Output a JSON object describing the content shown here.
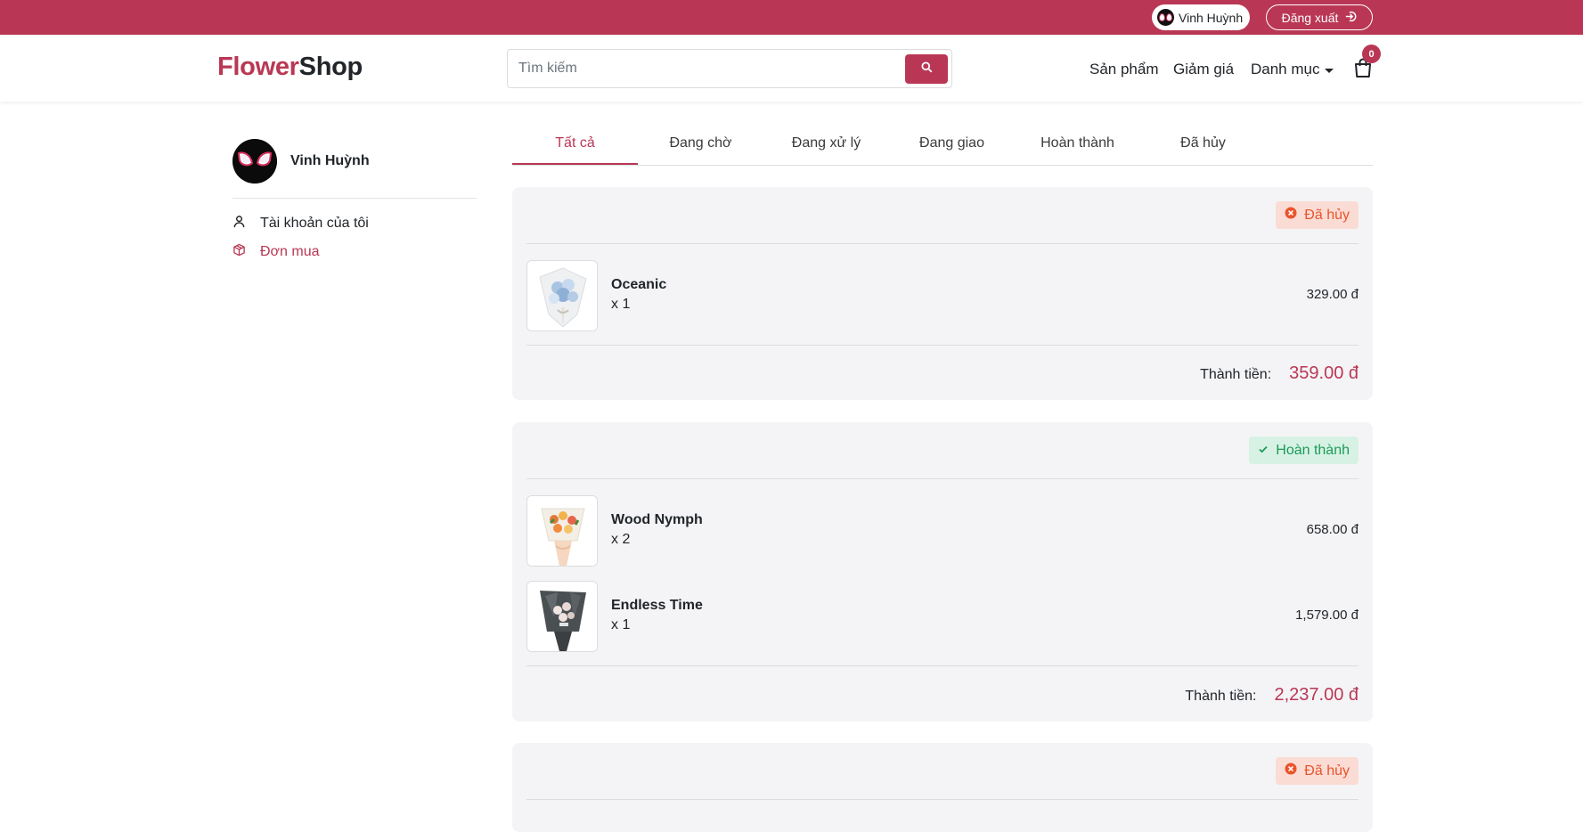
{
  "topbar": {
    "user_name": "Vinh Huỳnh",
    "logout_label": "Đăng xuất"
  },
  "header": {
    "logo_part1": "Flower",
    "logo_part2": "Shop",
    "search_placeholder": "Tìm kiếm",
    "nav": {
      "products": "Sản phẩm",
      "sale": "Giảm giá",
      "category": "Danh mục"
    },
    "cart_count": "0"
  },
  "sidebar": {
    "profile_name": "Vinh Huỳnh",
    "items": [
      {
        "label": "Tài khoản của tôi",
        "icon": "user-icon"
      },
      {
        "label": "Đơn mua",
        "icon": "box-icon",
        "active": true
      }
    ]
  },
  "tabs": [
    {
      "label": "Tất cả",
      "active": true
    },
    {
      "label": "Đang chờ"
    },
    {
      "label": "Đang xử lý"
    },
    {
      "label": "Đang giao"
    },
    {
      "label": "Hoàn thành"
    },
    {
      "label": "Đã hủy"
    }
  ],
  "orders": [
    {
      "status": "Đã hủy",
      "status_type": "cancelled",
      "items": [
        {
          "name": "Oceanic",
          "qty": "x 1",
          "price": "329.00 đ"
        }
      ],
      "total_label": "Thành tiền:",
      "total": "359.00 đ"
    },
    {
      "status": "Hoàn thành",
      "status_type": "completed",
      "items": [
        {
          "name": "Wood Nymph",
          "qty": "x 2",
          "price": "658.00 đ"
        },
        {
          "name": "Endless Time",
          "qty": "x 1",
          "price": "1,579.00 đ"
        }
      ],
      "total_label": "Thành tiền:",
      "total": "2,237.00 đ"
    },
    {
      "status": "Đã hủy",
      "status_type": "cancelled",
      "items": []
    }
  ],
  "colors": {
    "brand": "#b93755",
    "cancel_text": "#e8542c",
    "cancel_bg": "#fbdcd5",
    "done_text": "#1c9a59",
    "done_bg": "#d7f2e4"
  }
}
